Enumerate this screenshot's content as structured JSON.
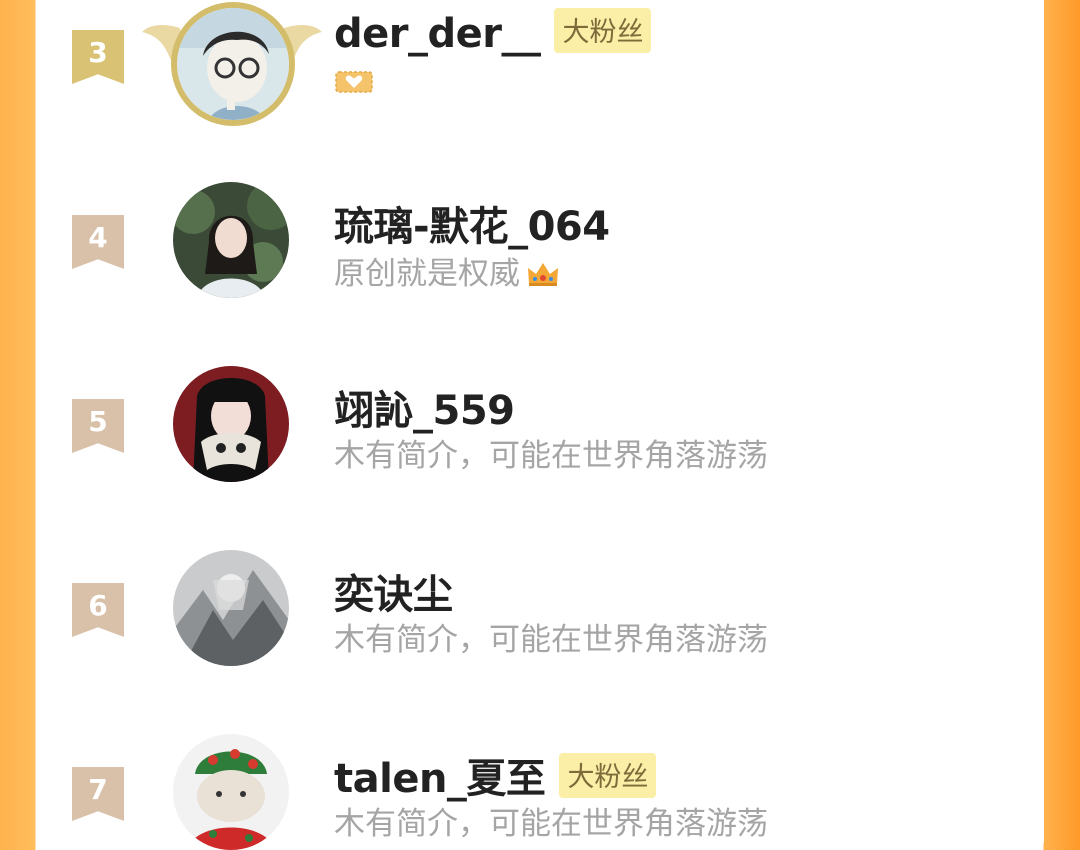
{
  "colors": {
    "side_band": "#ffb24d",
    "rank_gold": "#d9c273",
    "rank_default": "#d8c1a8",
    "badge_bg": "#fbeea6",
    "badge_text": "#7d6b3a",
    "name_text": "#222222",
    "bio_text": "#a5a5a5"
  },
  "rows": [
    {
      "rank": "3",
      "name": "der_der__",
      "badge": "大粉丝",
      "bio": "",
      "tag_icon": "fan-heart-icon"
    },
    {
      "rank": "4",
      "name": "琉璃-默花_064",
      "badge": "",
      "bio": "原创就是权威",
      "bio_icon": "crown-icon"
    },
    {
      "rank": "5",
      "name": "翊訫_559",
      "badge": "",
      "bio": "木有简介，可能在世界角落游荡"
    },
    {
      "rank": "6",
      "name": "奕诀尘",
      "badge": "",
      "bio": "木有简介，可能在世界角落游荡"
    },
    {
      "rank": "7",
      "name": "talen_夏至",
      "badge": "大粉丝",
      "bio": "木有简介，可能在世界角落游荡"
    }
  ]
}
